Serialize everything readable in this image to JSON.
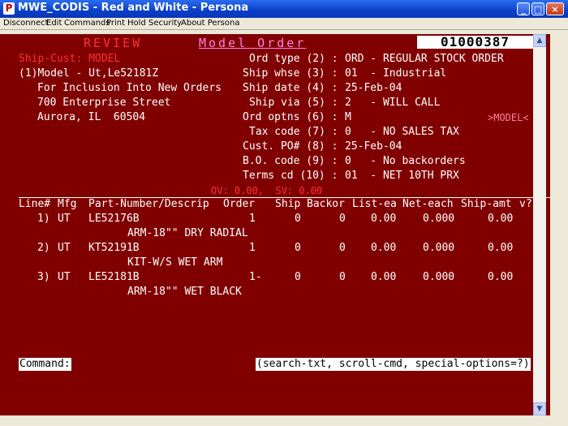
{
  "window": {
    "title": "MWE_CODIS - Red and White - Persona",
    "icon_letter": "P",
    "min": "_",
    "max": "□",
    "close": "×"
  },
  "menu": [
    "Disconnect",
    "Edit",
    "Commands",
    "Print",
    "Hold",
    "Security",
    "About Persona"
  ],
  "header": {
    "review": "REVIEW",
    "model_order": "Model Order",
    "order_number": "01000387"
  },
  "ship_cust": {
    "label": "Ship-Cust: MODEL",
    "line1": "(1)Model - Ut,Le52181Z",
    "line2": "For Inclusion Into New Orders",
    "line3": "700 Enterprise Street",
    "line4": "Aurora, IL  60504"
  },
  "fields": [
    {
      "label": "Ord type (2) :",
      "value": "ORD - REGULAR STOCK ORDER"
    },
    {
      "label": "Ship whse (3) :",
      "value": "01  - Industrial"
    },
    {
      "label": "Ship date (4) :",
      "value": "25-Feb-04"
    },
    {
      "label": "Ship via (5) :",
      "value": "2   - WILL CALL"
    },
    {
      "label": "Ord optns (6) :",
      "value": "M"
    },
    {
      "label": "Tax code (7) :",
      "value": "0   - NO SALES TAX"
    },
    {
      "label": "Cust. PO# (8) :",
      "value": "25-Feb-04"
    },
    {
      "label": "B.O. code (9) :",
      "value": "0   - No backorders"
    },
    {
      "label": "Terms cd (10) :",
      "value": "01  - NET 10TH PRX"
    }
  ],
  "model_tag": ">MODEL<",
  "totals": "OV: 0.00,  SV: 0.00",
  "columns": [
    "Line#",
    "Mfg",
    "Part-Number/Descrip",
    "Order",
    "Ship",
    "Backor",
    "List-ea",
    "Net-each",
    "Ship-amt",
    "v?"
  ],
  "lines": [
    {
      "line": "1)",
      "mfg": "UT",
      "part": "LE52176B",
      "order": "1",
      "ship": "0",
      "backor": "0",
      "list": "0.00",
      "net": "0.000",
      "amt": "0.00",
      "desc": "ARM-18\"\" DRY RADIAL"
    },
    {
      "line": "2)",
      "mfg": "UT",
      "part": "KT52191B",
      "order": "1",
      "ship": "0",
      "backor": "0",
      "list": "0.00",
      "net": "0.000",
      "amt": "0.00",
      "desc": "KIT-W/S WET ARM"
    },
    {
      "line": "3)",
      "mfg": "UT",
      "part": "LE52181B",
      "order": "1-",
      "ship": "0",
      "backor": "0",
      "list": "0.00",
      "net": "0.000",
      "amt": "0.00",
      "desc": "ARM-18\"\" WET BLACK"
    }
  ],
  "command": {
    "label": "Command:",
    "hint": "(search-txt, scroll-cmd, special-options=?)"
  },
  "scroll": {
    "up": "▲",
    "down": "▼"
  }
}
